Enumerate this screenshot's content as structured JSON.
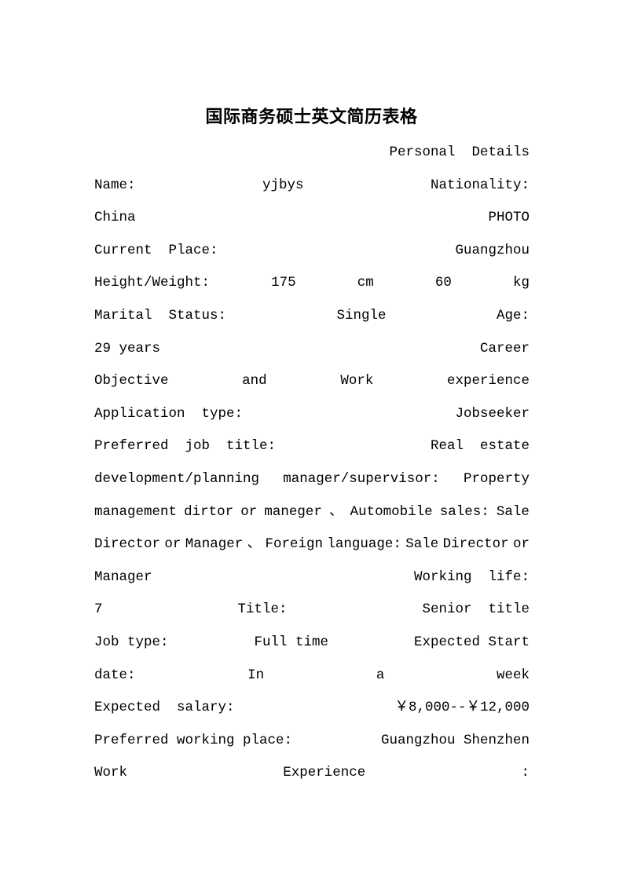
{
  "document": {
    "title": "国际商务硕士英文简历表格",
    "lines": [
      {
        "align": "right",
        "words": [
          "Personal  Details"
        ]
      },
      {
        "align": "justify",
        "words": [
          "Name:",
          "yjbys",
          "Nationality:"
        ]
      },
      {
        "align": "justify",
        "words": [
          "China",
          "PHOTO"
        ]
      },
      {
        "align": "justify",
        "words": [
          "Current  Place:",
          "Guangzhou"
        ]
      },
      {
        "align": "justify",
        "words": [
          "Height/Weight:",
          "175",
          "cm",
          "60",
          "kg"
        ]
      },
      {
        "align": "justify",
        "words": [
          "Marital  Status:",
          "Single",
          "Age:"
        ]
      },
      {
        "align": "justify",
        "words": [
          "29 years",
          "Career"
        ]
      },
      {
        "align": "justify",
        "words": [
          "Objective",
          "and",
          "Work",
          "experience"
        ]
      },
      {
        "align": "justify",
        "words": [
          "Application  type:",
          "Jobseeker"
        ]
      },
      {
        "align": "justify",
        "words": [
          "Preferred  job  title:",
          "Real  estate"
        ]
      },
      {
        "align": "justify",
        "words": [
          "development/planning",
          "manager/supervisor:",
          "Property"
        ]
      },
      {
        "align": "justify",
        "words": [
          "management",
          "dirtor",
          "or",
          "maneger",
          "、",
          "Automobile",
          "sales:",
          "Sale"
        ]
      },
      {
        "align": "justify",
        "words": [
          "Director",
          "or",
          "Manager",
          "、",
          "Foreign",
          "language:",
          "Sale",
          "Director",
          "or"
        ]
      },
      {
        "align": "justify",
        "words": [
          "Manager",
          "Working  life:"
        ]
      },
      {
        "align": "justify",
        "words": [
          "7",
          "Title:",
          "Senior  title"
        ]
      },
      {
        "align": "justify",
        "words": [
          "Job type:",
          "Full time",
          "Expected Start"
        ]
      },
      {
        "align": "justify",
        "words": [
          "date:",
          "In",
          "a",
          "week"
        ]
      },
      {
        "align": "justify",
        "words": [
          "Expected  salary:",
          "￥8,000--￥12,000"
        ]
      },
      {
        "align": "justify",
        "words": [
          "Preferred working place:",
          "Guangzhou Shenzhen"
        ]
      },
      {
        "align": "justify",
        "words": [
          "Work",
          "Experience",
          ":"
        ]
      }
    ]
  }
}
